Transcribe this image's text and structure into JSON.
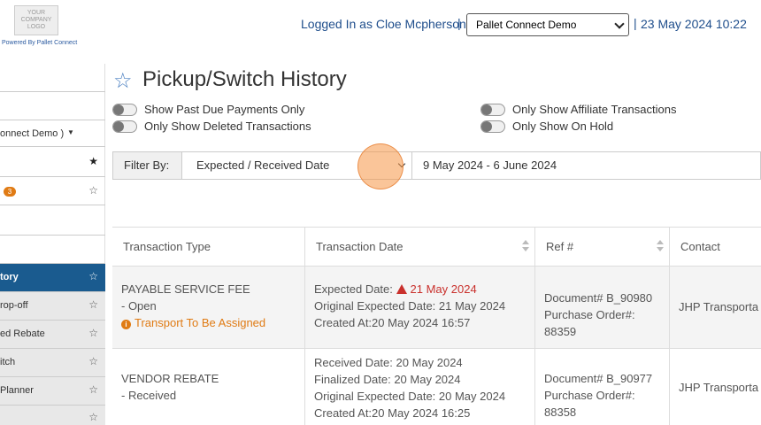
{
  "header": {
    "logo_text": "YOUR COMPANY LOGO",
    "powered_by": "Powered By Pallet Connect",
    "logged_in": "Logged In as Cloe Mcpherson",
    "separator": "|",
    "company_selected": "Pallet Connect Demo",
    "datetime": "23 May 2024 10:22"
  },
  "sidebar": {
    "company_label": "onnect Demo )",
    "badge_count": "3",
    "items": [
      {
        "label": "tory"
      },
      {
        "label": "rop-off"
      },
      {
        "label": "ed Rebate"
      },
      {
        "label": "itch"
      },
      {
        "label": "Planner"
      }
    ]
  },
  "page": {
    "title": "Pickup/Switch History"
  },
  "toggles": {
    "past_due": "Show Past Due Payments Only",
    "deleted": "Only Show Deleted Transactions",
    "affiliate": "Only Show Affiliate Transactions",
    "on_hold": "Only Show On Hold"
  },
  "filter": {
    "label": "Filter By:",
    "selected": "Expected / Received Date",
    "date_range": "9 May 2024 - 6 June 2024"
  },
  "table": {
    "headers": [
      "Transaction Type",
      "Transaction Date",
      "Ref #",
      "Contact"
    ],
    "rows": [
      {
        "type": "PAYABLE SERVICE FEE",
        "status": "- Open",
        "note": "Transport To Be Assigned",
        "date_label_1": "Expected Date:",
        "date_value_1": "21 May 2024",
        "date_line_2": "Original Expected Date: 21 May 2024",
        "date_line_3": "Created At:20 May 2024 16:57",
        "ref_1": "Document# B_90980",
        "ref_2": "Purchase Order#:",
        "ref_3": "88359",
        "contact": "JHP Transporta"
      },
      {
        "type": "VENDOR REBATE",
        "status": "- Received",
        "date_line_1": "Received Date: 20 May 2024",
        "date_line_2": "Finalized Date: 20 May 2024",
        "date_line_3": "Original Expected Date: 20 May 2024",
        "date_line_4": "Created At:20 May 2024 16:25",
        "ref_1": "Document# B_90977",
        "ref_2": "Purchase Order#:",
        "ref_3": "88358",
        "contact": "JHP Transporta"
      }
    ]
  }
}
